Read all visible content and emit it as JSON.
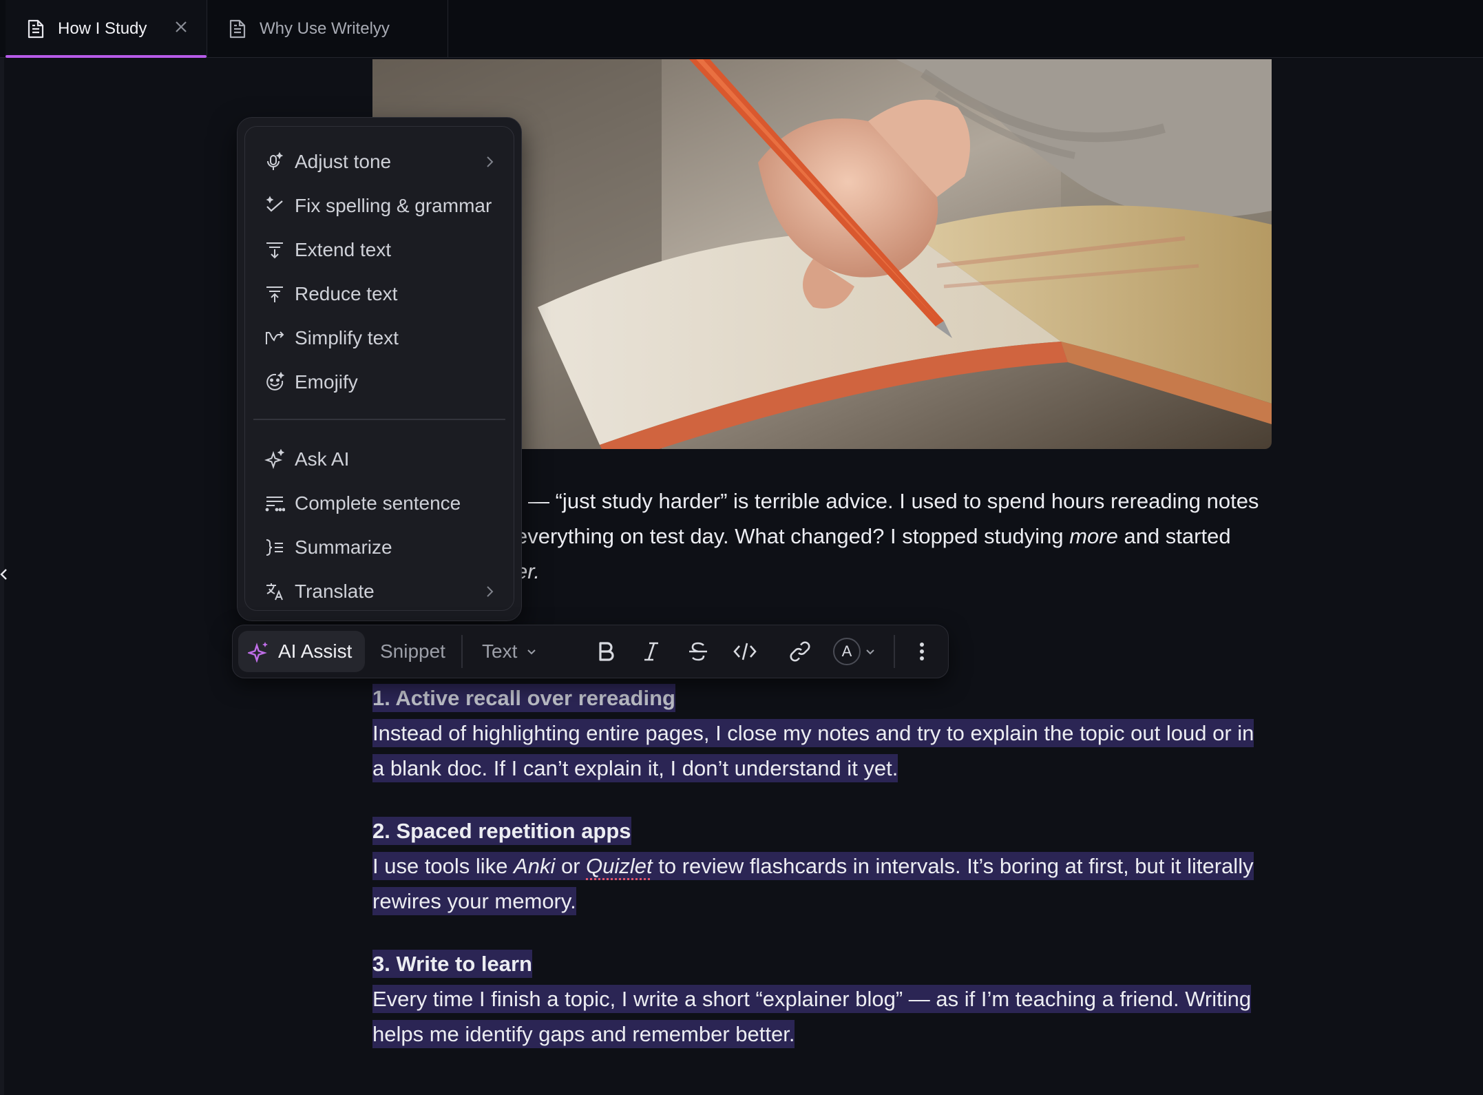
{
  "tabs": [
    {
      "label": "How I Study",
      "active": true
    },
    {
      "label": "Why Use Writelyy",
      "active": false
    }
  ],
  "intro": {
    "line1": "— “just study harder” is terrible advice. I used to spend hours rereading notes",
    "line2a": "everything on test day. What changed? I stopped studying ",
    "line2b": "more",
    "line2c": " and started",
    "line3": "er."
  },
  "ai_menu": {
    "items": [
      {
        "label": "Adjust tone",
        "icon": "mic-sparkle-icon",
        "submenu": true
      },
      {
        "label": "Fix spelling & grammar",
        "icon": "check-sparkle-icon",
        "submenu": false
      },
      {
        "label": "Extend text",
        "icon": "extend-text-icon",
        "submenu": false
      },
      {
        "label": "Reduce text",
        "icon": "reduce-text-icon",
        "submenu": false
      },
      {
        "label": "Simplify text",
        "icon": "simplify-icon",
        "submenu": false
      },
      {
        "label": "Emojify",
        "icon": "smile-icon",
        "submenu": false
      },
      {
        "label": "Ask AI",
        "icon": "sparkle-icon",
        "submenu": false
      },
      {
        "label": "Complete sentence",
        "icon": "complete-sentence-icon",
        "submenu": false
      },
      {
        "label": "Summarize",
        "icon": "summarize-icon",
        "submenu": false
      },
      {
        "label": "Translate",
        "icon": "translate-icon",
        "submenu": true
      }
    ]
  },
  "toolbar": {
    "ai_assist": "AI Assist",
    "snippet": "Snippet",
    "text_style": "Text",
    "color_letter": "A"
  },
  "sections": [
    {
      "heading": "1. Active recall over rereading",
      "body_line1": "Instead of highlighting entire pages, I close my notes and try to explain the topic out loud or in",
      "body_line2": "a blank doc. If I can’t explain it, I don’t understand it yet."
    },
    {
      "heading": "2. Spaced repetition apps",
      "body_pre": "I use tools like ",
      "body_anki": "Anki",
      "body_or": " or ",
      "body_quizlet": "Quizlet",
      "body_post": " to review flashcards in intervals. It’s boring at first, but it literally",
      "body_line2": "rewires your memory."
    },
    {
      "heading": "3. Write to learn",
      "body_line1": "Every time I finish a topic, I write a short “explainer blog” — as if I’m teaching a friend. Writing",
      "body_line2": "helps me identify gaps and remember better."
    }
  ],
  "colors": {
    "accent": "#b65be8",
    "selection": "#2b2554",
    "background": "#0e1016"
  }
}
